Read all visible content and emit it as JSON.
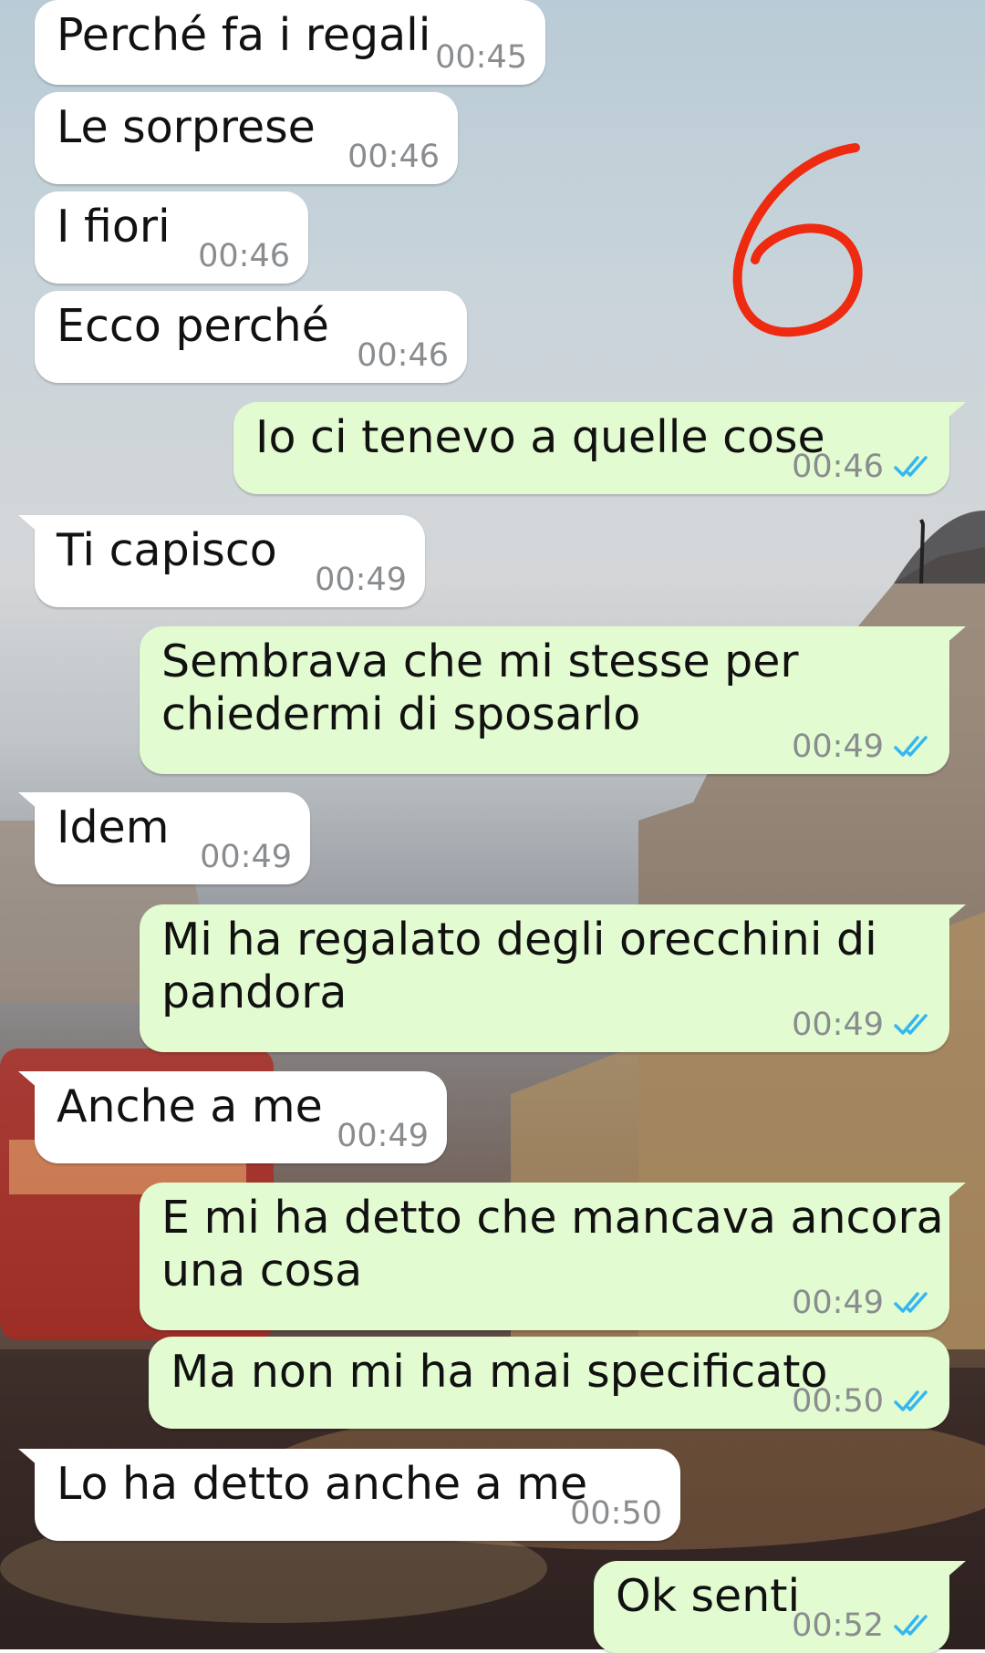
{
  "annotation_number": "6",
  "colors": {
    "incoming_bubble": "#ffffff",
    "outgoing_bubble": "#e2fbd0",
    "timestamp": "#8a8d90",
    "read_ticks": "#34b7f1",
    "annotation": "#ee2a10"
  },
  "messages": [
    {
      "direction": "in",
      "text": "Perché fa i regali",
      "time": "00:45"
    },
    {
      "direction": "in",
      "text": "Le sorprese",
      "time": "00:46"
    },
    {
      "direction": "in",
      "text": "I fiori",
      "time": "00:46"
    },
    {
      "direction": "in",
      "text": "Ecco perché",
      "time": "00:46"
    },
    {
      "direction": "out",
      "text": "Io ci tenevo a quelle cose",
      "time": "00:46",
      "status": "read"
    },
    {
      "direction": "in",
      "text": "Ti capisco",
      "time": "00:49"
    },
    {
      "direction": "out",
      "text": "Sembrava che mi stesse per\nchiedermi di sposarlo",
      "time": "00:49",
      "status": "read"
    },
    {
      "direction": "in",
      "text": "Idem",
      "time": "00:49"
    },
    {
      "direction": "out",
      "text": "Mi ha regalato degli orecchini di\npandora",
      "time": "00:49",
      "status": "read"
    },
    {
      "direction": "in",
      "text": "Anche a me",
      "time": "00:49"
    },
    {
      "direction": "out",
      "text": "E mi ha detto che mancava ancora\nuna cosa",
      "time": "00:49",
      "status": "read"
    },
    {
      "direction": "out",
      "text": "Ma non mi ha mai specificato",
      "time": "00:50",
      "status": "read"
    },
    {
      "direction": "in",
      "text": "Lo ha detto anche a me",
      "time": "00:50"
    },
    {
      "direction": "out",
      "text": "Ok senti",
      "time": "00:52",
      "status": "read"
    }
  ]
}
